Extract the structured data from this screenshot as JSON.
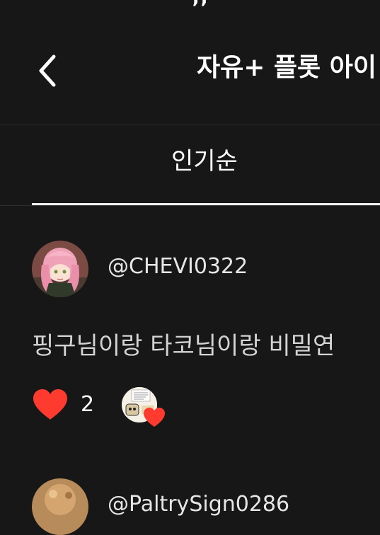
{
  "header": {
    "title": "자유+ 플롯 아이",
    "back_icon": "chevron-left-icon"
  },
  "tabs": {
    "popular_label": "인기순"
  },
  "comments": [
    {
      "username": "@CHEVI0322",
      "text": "핑구님이랑 타코님이랑 비밀연",
      "like_icon": "heart-icon",
      "like_color": "#ff3b30",
      "like_count": "2",
      "creator_heart_icon": "heart-icon"
    },
    {
      "username": "@PaltrySign0286"
    }
  ],
  "colors": {
    "background": "#171717",
    "text": "#ffffff",
    "divider": "#2c2c2c",
    "like": "#ff3b30"
  }
}
